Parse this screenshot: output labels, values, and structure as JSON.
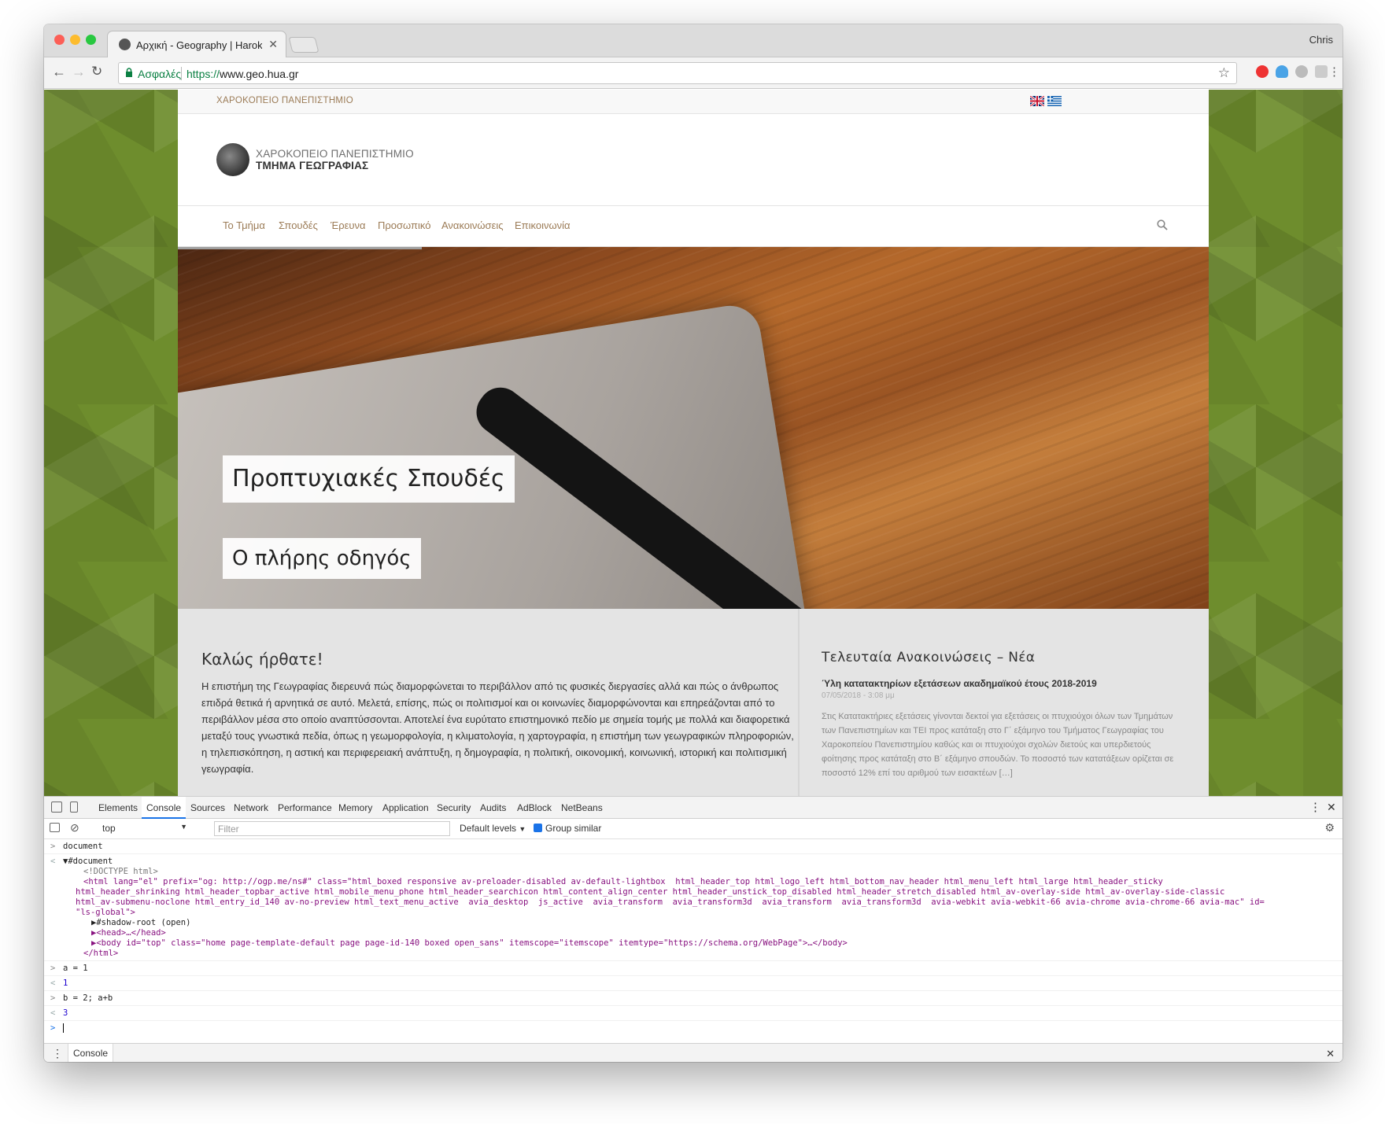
{
  "browser": {
    "tab_title": "Αρχική - Geography | Harokopio",
    "user": "Chris",
    "secure_label": "Ασφαλές",
    "url_scheme": "https://",
    "url_host": "www.geo.hua.gr"
  },
  "site": {
    "topbar_university": "ΧΑΡΟΚΟΠΕΙΟ ΠΑΝΕΠΙΣΤΗΜΙΟ",
    "logo_line1": "ΧΑΡΟΚΟΠΕΙΟ ΠΑΝΕΠΙΣΤΗΜΙΟ",
    "logo_line2": "ΤΜΗΜΑ ΓΕΩΓΡΑΦΙΑΣ",
    "nav": [
      "Το Τμήμα",
      "Σπουδές",
      "Έρευνα",
      "Προσωπικό",
      "Ανακοινώσεις",
      "Επικοινωνία"
    ],
    "hero_caption1": "Προπτυχιακές Σπουδές",
    "hero_caption2": "Ο πλήρης οδηγός",
    "welcome_title": "Καλώς ήρθατε!",
    "welcome_text": "Η επιστήμη της Γεωγραφίας διερευνά πώς διαμορφώνεται το περιβάλλον από τις φυσικές διεργασίες αλλά και πώς ο άνθρωπος επιδρά θετικά ή αρνητικά σε αυτό. Μελετά, επίσης, πώς οι πολιτισμοί και οι κοινωνίες διαμορφώνονται και επηρεάζονται από το περιβάλλον μέσα στο οποίο αναπτύσσονται. Αποτελεί ένα ευρύτατο επιστημονικό πεδίο με σημεία τομής με πολλά και διαφορετικά μεταξύ τους γνωστικά πεδία, όπως η γεωμορφολογία, η κλιματολογία, η χαρτογραφία, η επιστήμη των γεωγραφικών πληροφοριών, η τηλεπισκόπηση, η αστική και περιφερειακή ανάπτυξη, η δημογραφία, η πολιτική, οικονομική, κοινωνική, ιστορική και πολιτισμική γεωγραφία.",
    "news_heading": "Τελευταία Ανακοινώσεις – Νέα",
    "news_title": "Ύλη κατατακτηρίων εξετάσεων ακαδημαϊκού έτους 2018-2019",
    "news_date": "07/05/2018 - 3:08 μμ",
    "news_excerpt": "Στις Κατατακτήριες εξετάσεις γίνονται δεκτοί για εξετάσεις οι πτυχιούχοι όλων των Τμημάτων των Πανεπιστημίων και ΤΕΙ προς κατάταξη στο Γ΄ εξάμηνο του Τμήματος Γεωγραφίας του Χαροκοπείου Πανεπιστημίου καθώς και οι πτυχιούχοι σχολών διετούς και υπερδιετούς φοίτησης προς κατάταξη στο Β΄ εξάμηνο σπουδών. Το ποσοστό των κατατάξεων ορίζεται σε ποσοστό 12% επί του αριθμού των εισακτέων […]"
  },
  "devtools": {
    "tabs": [
      "Elements",
      "Console",
      "Sources",
      "Network",
      "Performance",
      "Memory",
      "Application",
      "Security",
      "Audits",
      "AdBlock",
      "NetBeans"
    ],
    "context": "top",
    "filter_placeholder": "Filter",
    "levels": "Default levels",
    "group_similar": "Group similar",
    "cmd1": "document",
    "doc_root": "#document",
    "doctype": "<!DOCTYPE html>",
    "html_open_1": "<html lang=\"el\" prefix=\"og: http://ogp.me/ns#\" class=\"html_boxed responsive av-preloader-disabled av-default-lightbox  html_header_top html_logo_left html_bottom_nav_header html_menu_left html_large html_header_sticky",
    "html_open_2": "html_header_shrinking html_header_topbar_active html_mobile_menu_phone html_header_searchicon html_content_align_center html_header_unstick_top_disabled html_header_stretch_disabled html_av-overlay-side html_av-overlay-side-classic",
    "html_open_3": "html_av-submenu-noclone html_entry_id_140 av-no-preview html_text_menu_active  avia_desktop  js_active  avia_transform  avia_transform3d  avia_transform  avia_transform3d  avia-webkit avia-webkit-66 avia-chrome avia-chrome-66 avia-mac\" id=",
    "html_open_4": "\"ls-global\">",
    "shadow": "#shadow-root (open)",
    "head": "<head>…</head>",
    "body": "<body id=\"top\" class=\"home page-template-default page page-id-140 boxed open_sans\" itemscope=\"itemscope\" itemtype=\"https://schema.org/WebPage\">…</body>",
    "html_close": "</html>",
    "cmd2": "a = 1",
    "res2": "1",
    "cmd3": "b = 2; a+b",
    "res3": "3",
    "drawer_tab": "Console"
  },
  "colors": {
    "page_bg": "#6e8d2d",
    "nav_text": "#9b7b56",
    "secure_green": "#0b8043"
  }
}
